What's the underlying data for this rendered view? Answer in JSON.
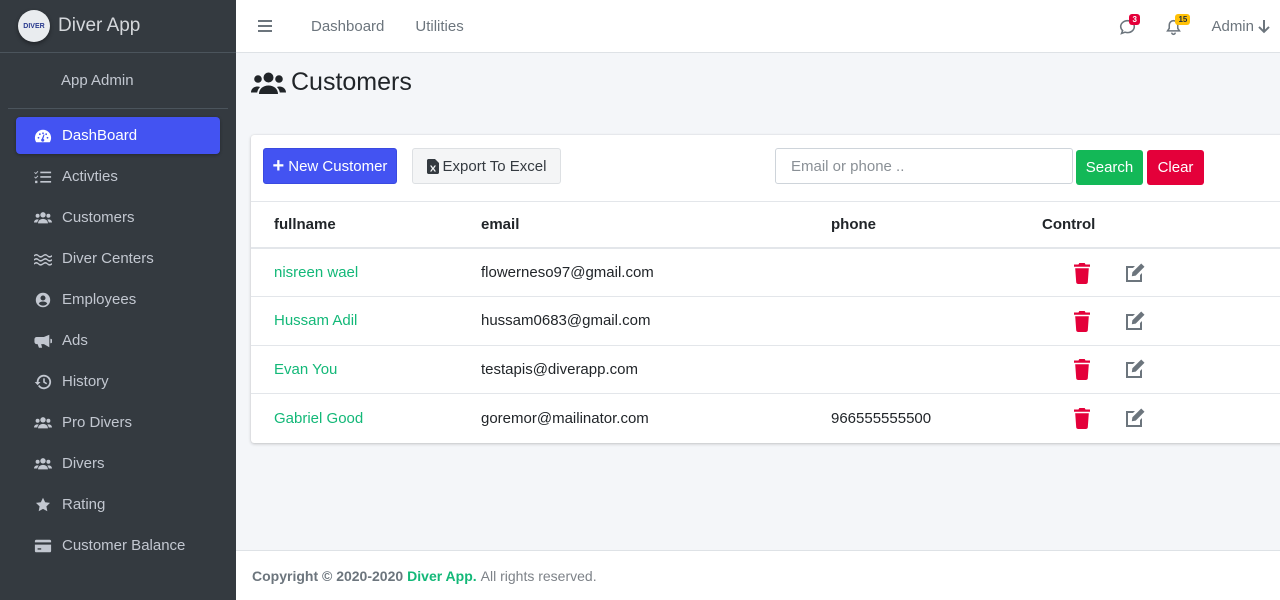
{
  "brand": {
    "name": "Diver App",
    "logo_text": "DIVER"
  },
  "user_panel": {
    "name": "App Admin"
  },
  "sidebar": {
    "items": [
      {
        "label": "DashBoard",
        "icon": "tachometer-icon",
        "active": true
      },
      {
        "label": "Activties",
        "icon": "list-check-icon"
      },
      {
        "label": "Customers",
        "icon": "users-icon"
      },
      {
        "label": "Diver Centers",
        "icon": "water-icon"
      },
      {
        "label": "Employees",
        "icon": "user-circle-icon"
      },
      {
        "label": "Ads",
        "icon": "bullhorn-icon"
      },
      {
        "label": "History",
        "icon": "history-icon"
      },
      {
        "label": "Pro Divers",
        "icon": "users-icon"
      },
      {
        "label": "Divers",
        "icon": "users-icon"
      },
      {
        "label": "Rating",
        "icon": "star-icon"
      },
      {
        "label": "Customer Balance",
        "icon": "credit-card-icon"
      }
    ]
  },
  "topbar": {
    "links": [
      "Dashboard",
      "Utilities"
    ],
    "messages_count": "3",
    "notifications_count": "15",
    "user_label": "Admin"
  },
  "page": {
    "title": "Customers"
  },
  "toolbar": {
    "new_label": "New Customer",
    "export_label": "Export To Excel",
    "search_placeholder": "Email or phone ..",
    "search_value": "",
    "search_label": "Search",
    "clear_label": "Clear"
  },
  "table": {
    "headers": [
      "fullname",
      "email",
      "phone",
      "Control"
    ],
    "rows": [
      {
        "fullname": "nisreen wael",
        "email": "flowerneso97@gmail.com",
        "phone": ""
      },
      {
        "fullname": "Hussam Adil",
        "email": "hussam0683@gmail.com",
        "phone": ""
      },
      {
        "fullname": "Evan You",
        "email": "testapis@diverapp.com",
        "phone": ""
      },
      {
        "fullname": "Gabriel Good",
        "email": "goremor@mailinator.com",
        "phone": "966555555500"
      }
    ]
  },
  "footer": {
    "copyright": "Copyright © 2020-2020",
    "brand": "Diver App.",
    "rights": "All rights reserved."
  },
  "colors": {
    "primary": "#4353f2",
    "success": "#13b857",
    "danger": "#e4003a",
    "link": "#13b878",
    "sidebar": "#343a40"
  }
}
